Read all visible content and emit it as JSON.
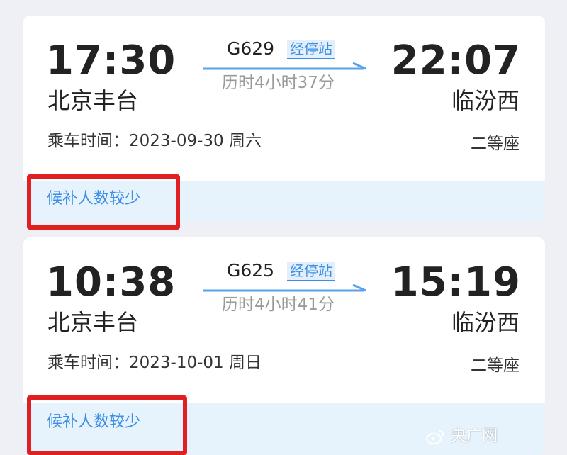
{
  "trips": [
    {
      "depart_time": "17:30",
      "arrive_time": "22:07",
      "depart_station": "北京丰台",
      "arrive_station": "临汾西",
      "train_no": "G629",
      "stops_link": "经停站",
      "duration": "历时4小时37分",
      "ride_label": "乘车时间：",
      "ride_date": "2023-09-30",
      "ride_weekday": "周六",
      "seat": "二等座",
      "status": "候补人数较少"
    },
    {
      "depart_time": "10:38",
      "arrive_time": "15:19",
      "depart_station": "北京丰台",
      "arrive_station": "临汾西",
      "train_no": "G625",
      "stops_link": "经停站",
      "duration": "历时4小时41分",
      "ride_label": "乘车时间：",
      "ride_date": "2023-10-01",
      "ride_weekday": "周日",
      "seat": "二等座",
      "status": "候补人数较少"
    }
  ],
  "watermark": {
    "text": "央广网",
    "icon": "weibo-icon"
  },
  "colors": {
    "accent": "#3a8ee6",
    "highlight": "#e02020",
    "status_bg": "#e6f2fc",
    "page_bg": "#eef0f5"
  }
}
